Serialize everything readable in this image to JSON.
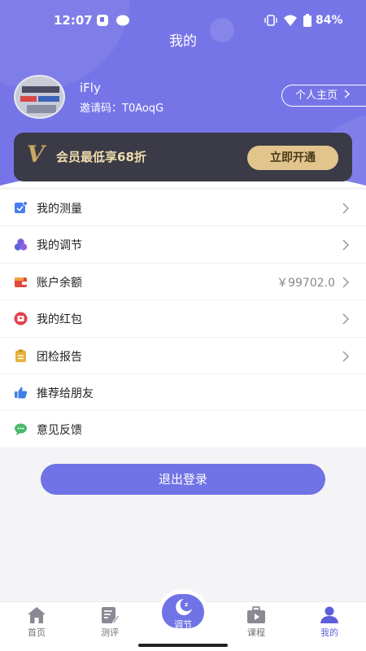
{
  "status_bar": {
    "time": "12:07",
    "battery": "84%"
  },
  "page": {
    "title": "我的"
  },
  "profile": {
    "username": "iFly",
    "invite_code": "邀请码：T0AoqG",
    "profile_button": "个人主页"
  },
  "vip": {
    "logo": "V",
    "text": "会员最低享68折",
    "button": "立即开通"
  },
  "menu": {
    "items": [
      {
        "label": "我的测量",
        "value": "",
        "icon": "measure-icon",
        "color": "#4a7df0"
      },
      {
        "label": "我的调节",
        "value": "",
        "icon": "adjust-icon",
        "color": "#6b5ad8"
      },
      {
        "label": "账户余额",
        "value": "￥99702.0",
        "icon": "wallet-icon",
        "color": "#e0473f"
      },
      {
        "label": "我的红包",
        "value": "",
        "icon": "red-packet-icon",
        "color": "#e2404c"
      },
      {
        "label": "团检报告",
        "value": "",
        "icon": "report-icon",
        "color": "#e4b33a"
      },
      {
        "label": "推荐给朋友",
        "value": "",
        "icon": "thumbs-up-icon",
        "color": "#3f7fe8"
      },
      {
        "label": "意见反馈",
        "value": "",
        "icon": "feedback-icon",
        "color": "#4bb86b"
      }
    ]
  },
  "logout": {
    "label": "退出登录"
  },
  "tabbar": {
    "tabs": [
      {
        "label": "首页",
        "icon": "home-icon"
      },
      {
        "label": "测评",
        "icon": "assessment-icon"
      },
      {
        "label": "调节",
        "icon": "moon-icon"
      },
      {
        "label": "课程",
        "icon": "course-icon"
      },
      {
        "label": "我的",
        "icon": "user-icon"
      }
    ],
    "active": "我的"
  },
  "colors": {
    "accent": "#7073e5",
    "header": "#7675e8",
    "vip_card": "#3a3b46",
    "vip_gold": "#e1c58c"
  }
}
